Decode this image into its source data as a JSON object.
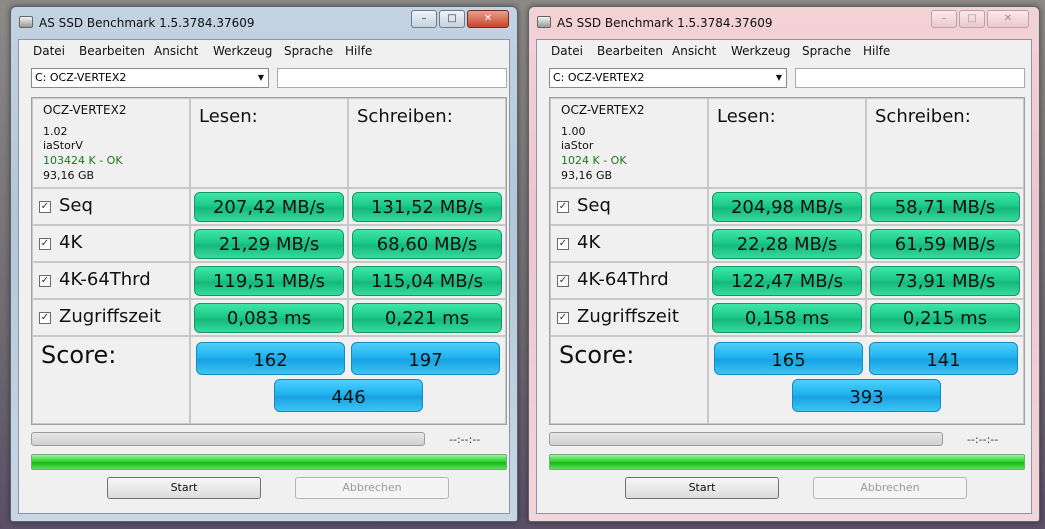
{
  "windows": [
    {
      "title": "AS SSD Benchmark 1.5.3784.37609",
      "menu": [
        "Datei",
        "Bearbeiten",
        "Ansicht",
        "Werkzeug",
        "Sprache",
        "Hilfe"
      ],
      "drive_select": "C: OCZ-VERTEX2",
      "info": {
        "name": "OCZ-VERTEX2",
        "firmware": "1.02",
        "driver": "iaStorV",
        "alignment": "103424 K - OK",
        "size": "93,16 GB"
      },
      "headers": {
        "read": "Lesen:",
        "write": "Schreiben:"
      },
      "rows": [
        {
          "label": "Seq",
          "read": "207,42 MB/s",
          "write": "131,52 MB/s"
        },
        {
          "label": "4K",
          "read": "21,29 MB/s",
          "write": "68,60 MB/s"
        },
        {
          "label": "4K-64Thrd",
          "read": "119,51 MB/s",
          "write": "115,04 MB/s"
        },
        {
          "label": "Zugriffszeit",
          "read": "0,083 ms",
          "write": "0,221 ms"
        }
      ],
      "score": {
        "label": "Score:",
        "read": "162",
        "write": "197",
        "total": "446"
      },
      "time": "--:--:--",
      "buttons": {
        "start": "Start",
        "abort": "Abbrechen"
      }
    },
    {
      "title": "AS SSD Benchmark 1.5.3784.37609",
      "menu": [
        "Datei",
        "Bearbeiten",
        "Ansicht",
        "Werkzeug",
        "Sprache",
        "Hilfe"
      ],
      "drive_select": "C: OCZ-VERTEX2",
      "info": {
        "name": "OCZ-VERTEX2",
        "firmware": "1.00",
        "driver": "iaStor",
        "alignment": "1024 K - OK",
        "size": "93,16 GB"
      },
      "headers": {
        "read": "Lesen:",
        "write": "Schreiben:"
      },
      "rows": [
        {
          "label": "Seq",
          "read": "204,98 MB/s",
          "write": "58,71 MB/s"
        },
        {
          "label": "4K",
          "read": "22,28 MB/s",
          "write": "61,59 MB/s"
        },
        {
          "label": "4K-64Thrd",
          "read": "122,47 MB/s",
          "write": "73,91 MB/s"
        },
        {
          "label": "Zugriffszeit",
          "read": "0,158 ms",
          "write": "0,215 ms"
        }
      ],
      "score": {
        "label": "Score:",
        "read": "165",
        "write": "141",
        "total": "393"
      },
      "time": "--:--:--",
      "buttons": {
        "start": "Start",
        "abort": "Abbrechen"
      }
    }
  ],
  "colors": {
    "result_green": "#1cc98a",
    "score_blue": "#1fb2ef",
    "progress_green": "#17b617"
  },
  "icons": {
    "app": "drive-icon",
    "checkbox": "checkmark-icon",
    "dropdown": "chevron-down-icon"
  }
}
